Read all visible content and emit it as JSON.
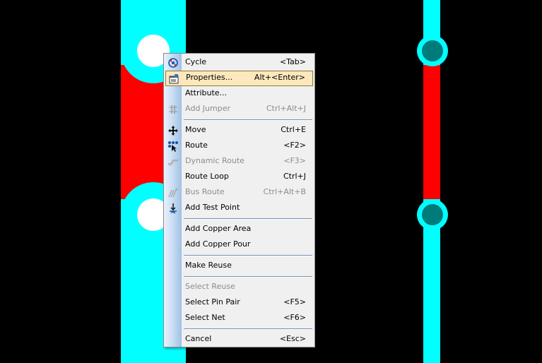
{
  "colors": {
    "background": "#000000",
    "trace_cyan": "#00ffff",
    "trace_red": "#ff0000",
    "pad_white": "#ffffff",
    "via_teal": "#007b7b",
    "menu_bg": "#f0f0f0",
    "menu_highlight": "#fce8bd",
    "menu_disabled_text": "#8c8c8c"
  },
  "context_menu": {
    "items": [
      {
        "label": "Cycle",
        "shortcut": "<Tab>",
        "icon": "cycle-icon",
        "disabled": false,
        "selected": false
      },
      {
        "label": "Properties...",
        "shortcut": "Alt+<Enter>",
        "icon": "properties-icon",
        "disabled": false,
        "selected": true
      },
      {
        "label": "Attribute...",
        "shortcut": "",
        "icon": "",
        "disabled": false,
        "selected": false
      },
      {
        "label": "Add Jumper",
        "shortcut": "Ctrl+Alt+J",
        "icon": "add-jumper-icon",
        "disabled": true,
        "selected": false
      },
      {
        "label": "Move",
        "shortcut": "Ctrl+E",
        "icon": "move-icon",
        "disabled": false,
        "selected": false
      },
      {
        "label": "Route",
        "shortcut": "<F2>",
        "icon": "route-icon",
        "disabled": false,
        "selected": false
      },
      {
        "label": "Dynamic Route",
        "shortcut": "<F3>",
        "icon": "dynamic-route-icon",
        "disabled": true,
        "selected": false
      },
      {
        "label": "Route Loop",
        "shortcut": "Ctrl+J",
        "icon": "",
        "disabled": false,
        "selected": false
      },
      {
        "label": "Bus Route",
        "shortcut": "Ctrl+Alt+B",
        "icon": "bus-route-icon",
        "disabled": true,
        "selected": false
      },
      {
        "label": "Add Test Point",
        "shortcut": "",
        "icon": "test-point-icon",
        "disabled": false,
        "selected": false
      },
      {
        "label": "Add Copper Area",
        "shortcut": "",
        "icon": "",
        "disabled": false,
        "selected": false
      },
      {
        "label": "Add Copper Pour",
        "shortcut": "",
        "icon": "",
        "disabled": false,
        "selected": false
      },
      {
        "label": "Make Reuse",
        "shortcut": "",
        "icon": "",
        "disabled": false,
        "selected": false
      },
      {
        "label": "Select Reuse",
        "shortcut": "",
        "icon": "",
        "disabled": true,
        "selected": false
      },
      {
        "label": "Select Pin Pair",
        "shortcut": "<F5>",
        "icon": "",
        "disabled": false,
        "selected": false
      },
      {
        "label": "Select Net",
        "shortcut": "<F6>",
        "icon": "",
        "disabled": false,
        "selected": false
      },
      {
        "label": "Cancel",
        "shortcut": "<Esc>",
        "icon": "",
        "disabled": false,
        "selected": false
      }
    ]
  }
}
